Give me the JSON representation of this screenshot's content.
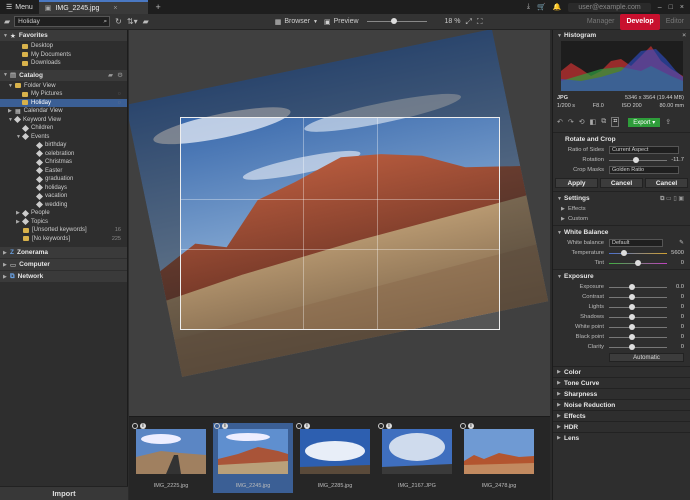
{
  "titlebar": {
    "menu": "Menu",
    "tab": "IMG_2245.jpg",
    "user": "user@example.com"
  },
  "toolbar": {
    "search": "Holiday",
    "browser": "Browser",
    "preview": "Preview",
    "zoom": "18 %",
    "zoom_fraction": 0.45,
    "modes": [
      "Manager",
      "Develop",
      "Editor"
    ]
  },
  "left": {
    "favorites": {
      "title": "Favorites",
      "items": [
        "Desktop",
        "My Documents",
        "Downloads"
      ]
    },
    "catalog": {
      "title": "Catalog",
      "folder_view": "Folder View",
      "folders": [
        "My Pictures",
        "Holiday"
      ],
      "folder_counts": [
        "1",
        "1"
      ],
      "calendar_view": "Calendar View",
      "keyword_view": "Keyword View",
      "keywords": [
        "Children",
        "Events",
        "birthday",
        "celebration",
        "Christmas",
        "Easter",
        "graduation",
        "holidays",
        "vacation",
        "wedding",
        "People",
        "Topics",
        "[Unsorted keywords]",
        "[No keywords]"
      ],
      "keyword_counts": {
        "12": "16",
        "13": "225"
      }
    },
    "zonerama": "Zonerama",
    "computer": "Computer",
    "network": "Network",
    "import": "Import"
  },
  "filmstrip": [
    {
      "name": "IMG_2225.jpg"
    },
    {
      "name": "IMG_2245.jpg",
      "selected": true
    },
    {
      "name": "IMG_2285.jpg"
    },
    {
      "name": "IMG_2167.JPG"
    },
    {
      "name": "IMG_2478.jpg"
    }
  ],
  "right": {
    "histogram": "Histogram",
    "info": {
      "format": "JPG",
      "dims": "5346 x 3564 (19.44 MB)",
      "shutter": "1/200 s",
      "aperture": "F8.0",
      "iso": "ISO 200",
      "focal": "80.00 mm"
    },
    "export": "Export",
    "rotate_crop": {
      "title": "Rotate and Crop",
      "ratio_label": "Ratio of Sides",
      "ratio": "Current Aspect",
      "rotation_label": "Rotation",
      "rotation": "-11.7",
      "mask_label": "Crop Masks",
      "mask": "Golden Ratio"
    },
    "buttons": [
      "Apply",
      "Cancel",
      "Cancel"
    ],
    "settings": {
      "title": "Settings",
      "items": [
        "Effects",
        "Custom"
      ]
    },
    "wb": {
      "title": "White Balance",
      "label": "White balance",
      "value": "Default",
      "temp_label": "Temperature",
      "temp": "5600",
      "tint_label": "Tint",
      "tint": "0"
    },
    "exposure": {
      "title": "Exposure",
      "rows": [
        [
          "Exposure",
          "0.0"
        ],
        [
          "Contrast",
          "0"
        ],
        [
          "Lights",
          "0"
        ],
        [
          "Shadows",
          "0"
        ],
        [
          "White point",
          "0"
        ],
        [
          "Black point",
          "0"
        ],
        [
          "Clarity",
          "0"
        ]
      ],
      "auto": "Automatic"
    },
    "sections": [
      "Color",
      "Tone Curve",
      "Sharpness",
      "Noise Reduction",
      "Effects",
      "HDR",
      "Lens"
    ]
  },
  "colors": {
    "accent": "#c8102e",
    "select": "#3b5f95",
    "export": "#2e9d3a"
  }
}
